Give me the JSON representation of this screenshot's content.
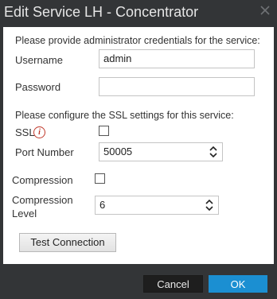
{
  "window": {
    "title": "Edit Service LH - Concentrator",
    "close_icon": "close-icon"
  },
  "credentials": {
    "prompt": "Please provide administrator credentials for the service:",
    "username_label": "Username",
    "username_value": "admin",
    "password_label": "Password",
    "password_value": ""
  },
  "ssl": {
    "prompt": "Please configure the SSL settings for this service:",
    "ssl_label": "SSL",
    "info_icon": "info-icon",
    "info_glyph": "i",
    "ssl_checked": false,
    "port_label": "Port Number",
    "port_value": "50005"
  },
  "compression": {
    "compression_label": "Compression",
    "compression_checked": false,
    "level_label_line1": "Compression",
    "level_label_line2": "Level",
    "level_value": "6"
  },
  "actions": {
    "test_connection_label": "Test Connection",
    "cancel_label": "Cancel",
    "ok_label": "OK"
  },
  "colors": {
    "dialog_background": "#333537",
    "content_background": "#ffffff",
    "primary_button": "#1b8fd2",
    "secondary_button": "#1e1e1e",
    "info_accent": "#c0392b"
  }
}
